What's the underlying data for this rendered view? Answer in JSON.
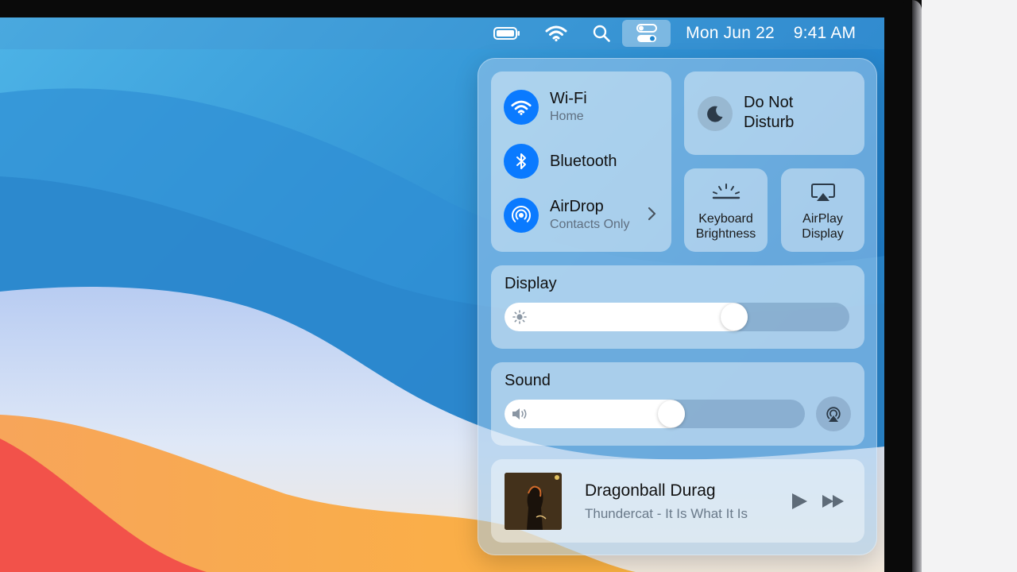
{
  "menubar": {
    "icons": [
      "battery-icon",
      "wifi-icon",
      "search-icon",
      "control-center-icon"
    ],
    "date": "Mon Jun 22",
    "time": "9:41 AM"
  },
  "control_center": {
    "network": {
      "wifi": {
        "title": "Wi-Fi",
        "subtitle": "Home",
        "icon": "wifi-icon",
        "enabled": true
      },
      "bluetooth": {
        "title": "Bluetooth",
        "icon": "bluetooth-icon",
        "enabled": true
      },
      "airdrop": {
        "title": "AirDrop",
        "subtitle": "Contacts Only",
        "icon": "airdrop-icon",
        "enabled": true
      }
    },
    "do_not_disturb": {
      "label": "Do Not Disturb",
      "icon": "moon-icon"
    },
    "keyboard_brightness": {
      "label_line1": "Keyboard",
      "label_line2": "Brightness",
      "icon": "keyboard-brightness-icon"
    },
    "airplay_display": {
      "label_line1": "AirPlay",
      "label_line2": "Display",
      "icon": "airplay-display-icon"
    },
    "display": {
      "title": "Display",
      "level": 0.68,
      "icon": "sun-icon"
    },
    "sound": {
      "title": "Sound",
      "level": 0.56,
      "icon": "speaker-icon"
    },
    "now_playing": {
      "title": "Dragonball Durag",
      "subtitle": "Thundercat - It Is What It Is",
      "controls": [
        "play-icon",
        "fast-forward-icon"
      ]
    }
  },
  "colors": {
    "accent": "#0a7aff"
  }
}
